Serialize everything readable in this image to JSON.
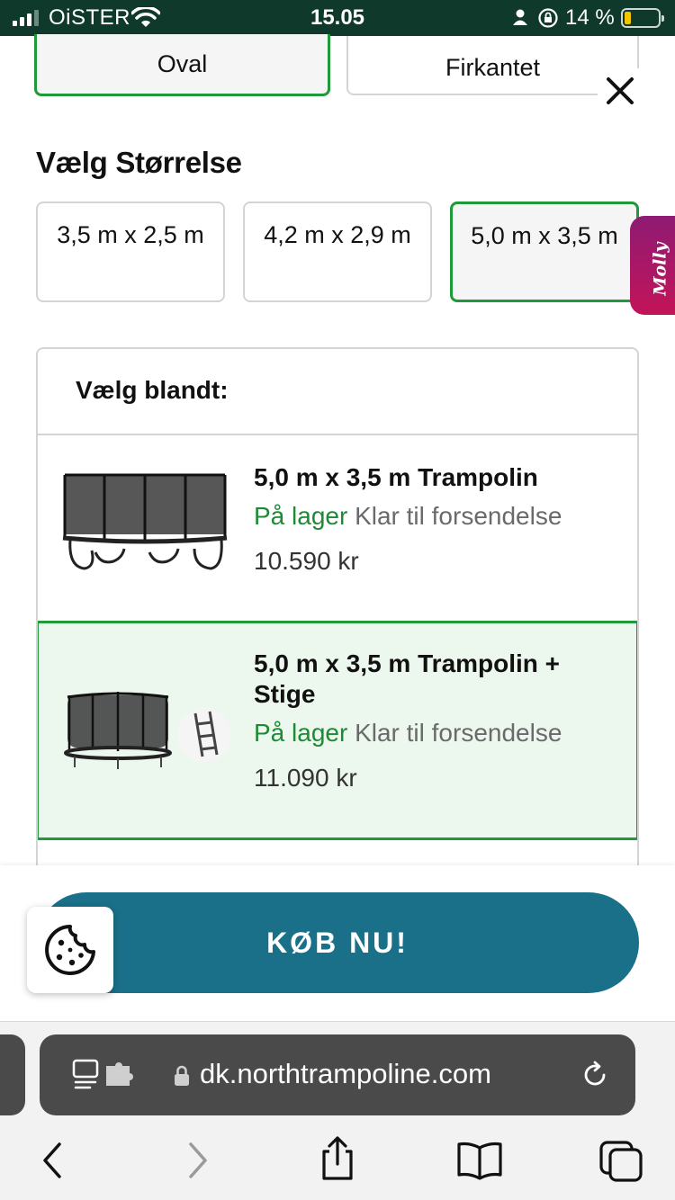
{
  "status_bar": {
    "carrier": "OiSTER",
    "time": "15.05",
    "battery_percent": "14 %"
  },
  "shape_options": [
    {
      "label": "Oval",
      "selected": true
    },
    {
      "label": "Firkantet",
      "selected": false
    }
  ],
  "size_section": {
    "title": "Vælg Størrelse",
    "options": [
      {
        "label": "3,5 m x 2,5 m",
        "selected": false
      },
      {
        "label": "4,2 m x 2,9 m",
        "selected": false
      },
      {
        "label": "5,0 m x 3,5 m",
        "selected": true
      }
    ]
  },
  "chat_widget": {
    "label": "Molly"
  },
  "variants": {
    "title": "Vælg blandt:",
    "items": [
      {
        "name": "5,0 m x 3,5 m Trampolin",
        "stock_status": "På lager",
        "shipping": "Klar til forsendelse",
        "price": "10.590 kr",
        "selected": false
      },
      {
        "name": "5,0 m x 3,5 m Trampolin + Stige",
        "stock_status": "På lager",
        "shipping": "Klar til forsendelse",
        "price": "11.090 kr",
        "selected": true
      }
    ]
  },
  "buy_button": {
    "label": "KØB NU!"
  },
  "browser": {
    "url": "dk.northtrampoline.com"
  },
  "colors": {
    "brand_green": "#1f9a3a",
    "in_stock_green": "#1f8a36",
    "buy_button": "#1a7088",
    "status_bar_bg": "#0f3a2b",
    "molly_gradient_start": "#8e1b73",
    "molly_gradient_end": "#c31458"
  }
}
